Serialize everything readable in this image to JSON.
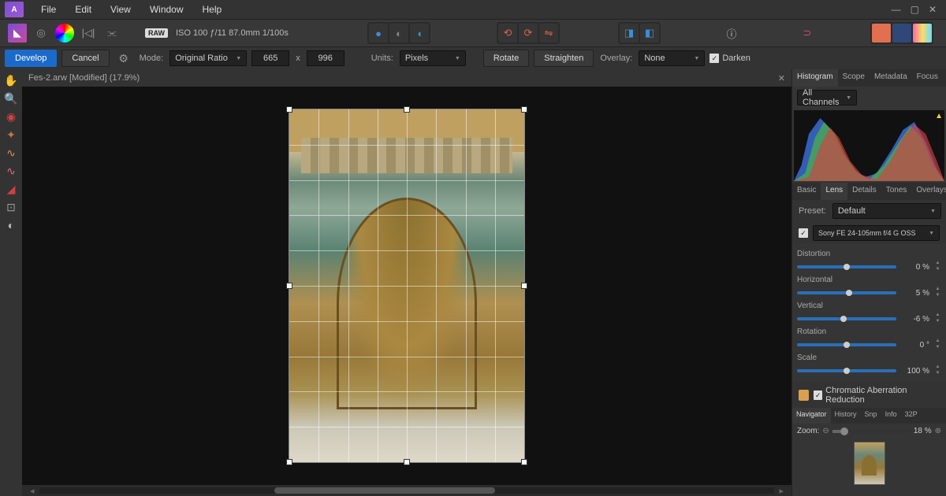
{
  "menu": {
    "file": "File",
    "edit": "Edit",
    "view": "View",
    "window": "Window",
    "help": "Help"
  },
  "rawinfo": "ISO 100 ƒ/11 87.0mm 1/100s",
  "rawbadge": "RAW",
  "toolbar": {
    "develop": "Develop",
    "cancel": "Cancel",
    "mode": "Mode:",
    "ratio": "Original Ratio",
    "w": "665",
    "x": "x",
    "h": "996",
    "units": "Units:",
    "unitval": "Pixels",
    "rotate": "Rotate",
    "straighten": "Straighten",
    "overlay": "Overlay:",
    "overlayval": "None",
    "darken": "Darken"
  },
  "doc": {
    "tab": "Fes-2.arw [Modified] (17.9%)"
  },
  "panel": {
    "tabs": {
      "histogram": "Histogram",
      "scope": "Scope",
      "metadata": "Metadata",
      "focus": "Focus"
    },
    "channels": "All Channels",
    "subtabs": {
      "basic": "Basic",
      "lens": "Lens",
      "details": "Details",
      "tones": "Tones",
      "overlays": "Overlays"
    },
    "preset_label": "Preset:",
    "preset_val": "Default",
    "lens": "Sony FE 24-105mm f/4 G OSS",
    "sliders": [
      {
        "label": "Distortion",
        "val": "0 %",
        "pos": 50
      },
      {
        "label": "Horizontal",
        "val": "5 %",
        "pos": 52
      },
      {
        "label": "Vertical",
        "val": "-6 %",
        "pos": 47
      },
      {
        "label": "Rotation",
        "val": "0 °",
        "pos": 50
      },
      {
        "label": "Scale",
        "val": "100 %",
        "pos": 50
      }
    ],
    "chroma": "Chromatic Aberration Reduction",
    "nav": {
      "navigator": "Navigator",
      "history": "History",
      "snp": "Snp",
      "info": "Info",
      "p32": "32P"
    },
    "zoom_label": "Zoom:",
    "zoom_val": "18 %"
  }
}
